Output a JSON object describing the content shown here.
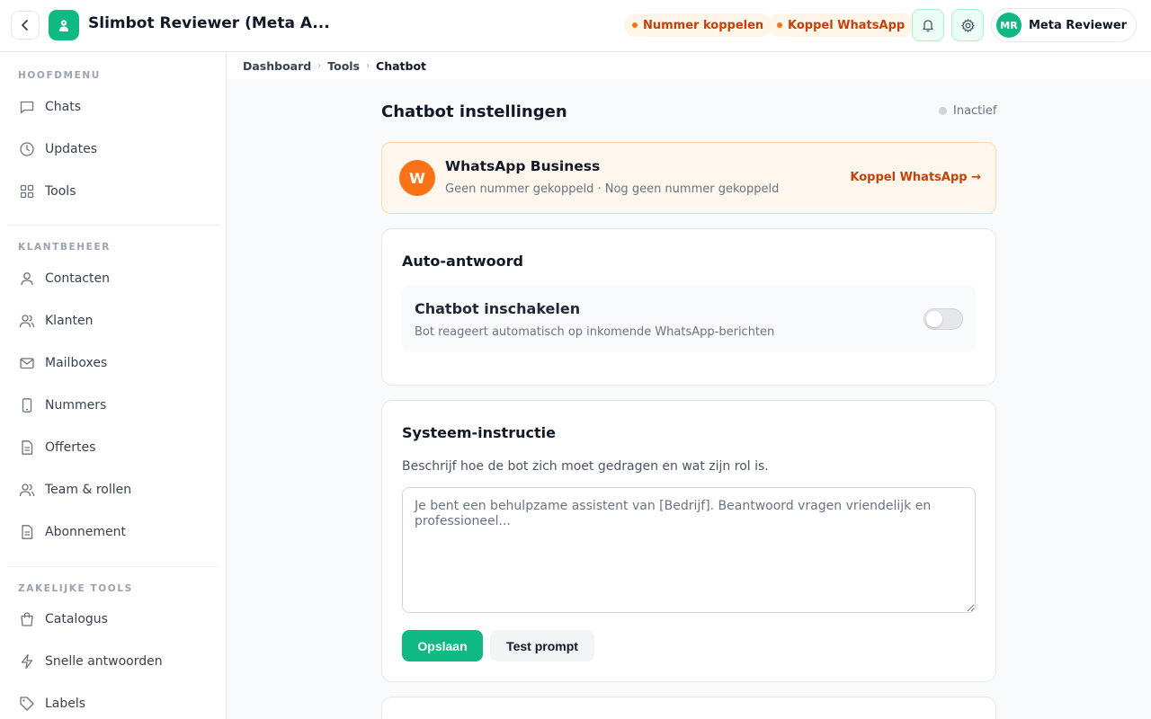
{
  "header": {
    "back_icon": "chevron-left-icon",
    "logo_icon": "robot-icon",
    "app_title": "Slimbot Reviewer (Meta A...",
    "pills": [
      {
        "label": "Nummer koppelen",
        "dot_color": "#f97316"
      },
      {
        "label": "Koppel WhatsApp",
        "dot_color": "#f97316"
      }
    ],
    "bell_icon": "bell-icon",
    "gear_icon": "gear-icon",
    "user": {
      "initials": "MR",
      "name": "Meta Reviewer"
    }
  },
  "sidebar": {
    "sections": [
      {
        "title": "HOOFDMENU",
        "items": [
          {
            "label": "Chats",
            "icon": "chat-bubble-icon"
          },
          {
            "label": "Updates",
            "icon": "clock-icon"
          },
          {
            "label": "Tools",
            "icon": "grid-icon"
          }
        ]
      },
      {
        "title": "KLANTBEHEER",
        "items": [
          {
            "label": "Contacten",
            "icon": "user-icon"
          },
          {
            "label": "Klanten",
            "icon": "users-icon"
          },
          {
            "label": "Mailboxes",
            "icon": "mail-icon"
          },
          {
            "label": "Nummers",
            "icon": "phone-icon"
          },
          {
            "label": "Offertes",
            "icon": "document-icon"
          },
          {
            "label": "Team & rollen",
            "icon": "team-icon"
          },
          {
            "label": "Abonnement",
            "icon": "document-icon"
          }
        ]
      },
      {
        "title": "ZAKELIJKE TOOLS",
        "items": [
          {
            "label": "Catalogus",
            "icon": "shopping-bag-icon"
          },
          {
            "label": "Snelle antwoorden",
            "icon": "lightning-icon"
          },
          {
            "label": "Labels",
            "icon": "tag-icon"
          }
        ]
      }
    ]
  },
  "breadcrumb": [
    "Dashboard",
    "Tools",
    "Chatbot"
  ],
  "page": {
    "title": "Chatbot instellingen",
    "status": "Inactief"
  },
  "whatsapp_card": {
    "avatar_letter": "W",
    "title": "WhatsApp Business",
    "subtitle": "Geen nummer gekoppeld · Nog geen nummer gekoppeld",
    "link": "Koppel WhatsApp →"
  },
  "auto_reply": {
    "title": "Auto-antwoord",
    "toggle_title": "Chatbot inschakelen",
    "toggle_desc": "Bot reageert automatisch op inkomende WhatsApp-berichten",
    "enabled": false
  },
  "system_instruction": {
    "title": "Systeem-instructie",
    "description": "Beschrijf hoe de bot zich moet gedragen en wat zijn rol is.",
    "placeholder": "Je bent een behulpzame assistent van [Bedrijf]. Beantwoord vragen vriendelijk en professioneel...",
    "value": "",
    "save_label": "Opslaan",
    "test_label": "Test prompt"
  },
  "colors": {
    "accent": "#10b981",
    "warning": "#f97316",
    "warning_text": "#c2410c"
  }
}
